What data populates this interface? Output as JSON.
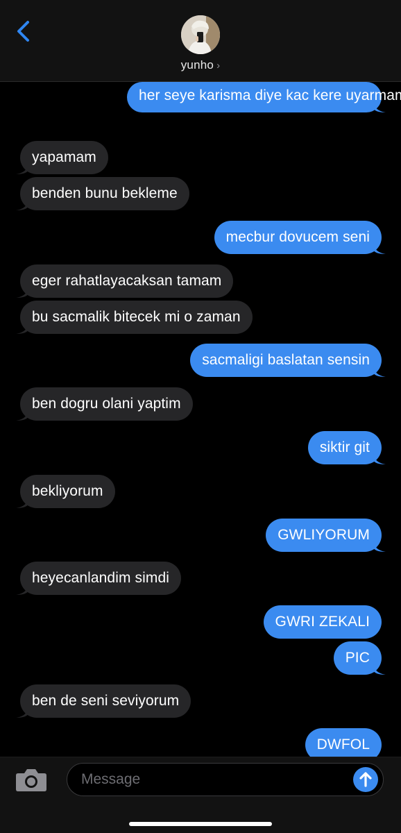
{
  "header": {
    "contact_name": "yunho",
    "name_chevron": "›",
    "back_icon": "chevron-left-icon",
    "avatar": "contact-avatar-photo"
  },
  "colors": {
    "outgoing_bubble": "#3b8bf0",
    "incoming_bubble": "#262628",
    "accent": "#3b8bf0",
    "background": "#000000"
  },
  "messages": [
    {
      "dir": "out",
      "text": "her seye karisma diye kac kere uyarmam gerekiyor"
    },
    {
      "dir": "in",
      "text": "yapamam"
    },
    {
      "dir": "in",
      "text": "benden bunu bekleme"
    },
    {
      "dir": "out",
      "text": "mecbur dovucem seni"
    },
    {
      "dir": "in",
      "text": "eger rahatlayacaksan tamam"
    },
    {
      "dir": "in",
      "text": "bu sacmalik bitecek mi o zaman"
    },
    {
      "dir": "out",
      "text": "sacmaligi baslatan sensin"
    },
    {
      "dir": "in",
      "text": "ben dogru olani yaptim"
    },
    {
      "dir": "out",
      "text": "siktir git"
    },
    {
      "dir": "in",
      "text": "bekliyorum"
    },
    {
      "dir": "out",
      "text": "GWLIYORUM"
    },
    {
      "dir": "in",
      "text": "heyecanlandim simdi"
    },
    {
      "dir": "out",
      "text": "GWRI ZEKALI"
    },
    {
      "dir": "out",
      "text": "PIC"
    },
    {
      "dir": "in",
      "text": "ben de seni seviyorum"
    },
    {
      "dir": "out",
      "text": "DWFOL"
    }
  ],
  "composer": {
    "placeholder": "Message",
    "camera_icon": "camera-icon",
    "send_icon": "arrow-up-icon"
  }
}
